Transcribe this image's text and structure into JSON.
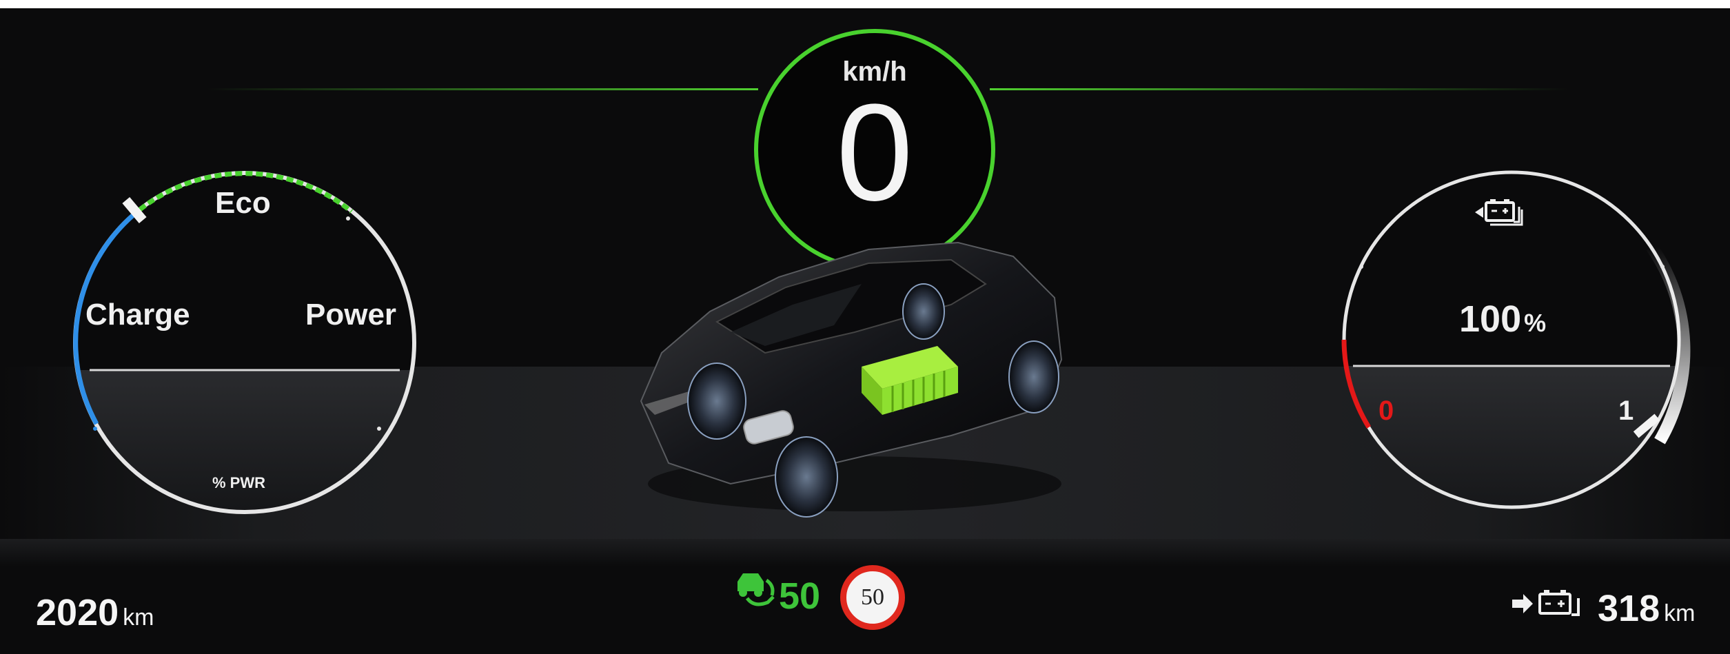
{
  "speed": {
    "unit": "km/h",
    "value": "0"
  },
  "power_gauge": {
    "labels": {
      "eco": "Eco",
      "charge": "Charge",
      "power": "Power",
      "pwr": "% PWR"
    }
  },
  "battery_gauge": {
    "percent": "100",
    "percent_unit": "%",
    "scale_min": "0",
    "scale_max": "1",
    "level_fraction": 1.0,
    "icon": "battery-regen-icon"
  },
  "odometer": {
    "value": "2020",
    "unit": "km"
  },
  "range": {
    "value": "318",
    "unit": "km",
    "icon": "battery-range-icon"
  },
  "speed_assist": {
    "value": "50",
    "icon": "speed-limiter-icon"
  },
  "speed_limit_sign": {
    "value": "50"
  },
  "colors": {
    "accent_green": "#49d22e",
    "charge_blue": "#2f8fe8",
    "warning_red": "#e41818",
    "battery_green": "#8ee030",
    "sign_red": "#e0281e"
  }
}
